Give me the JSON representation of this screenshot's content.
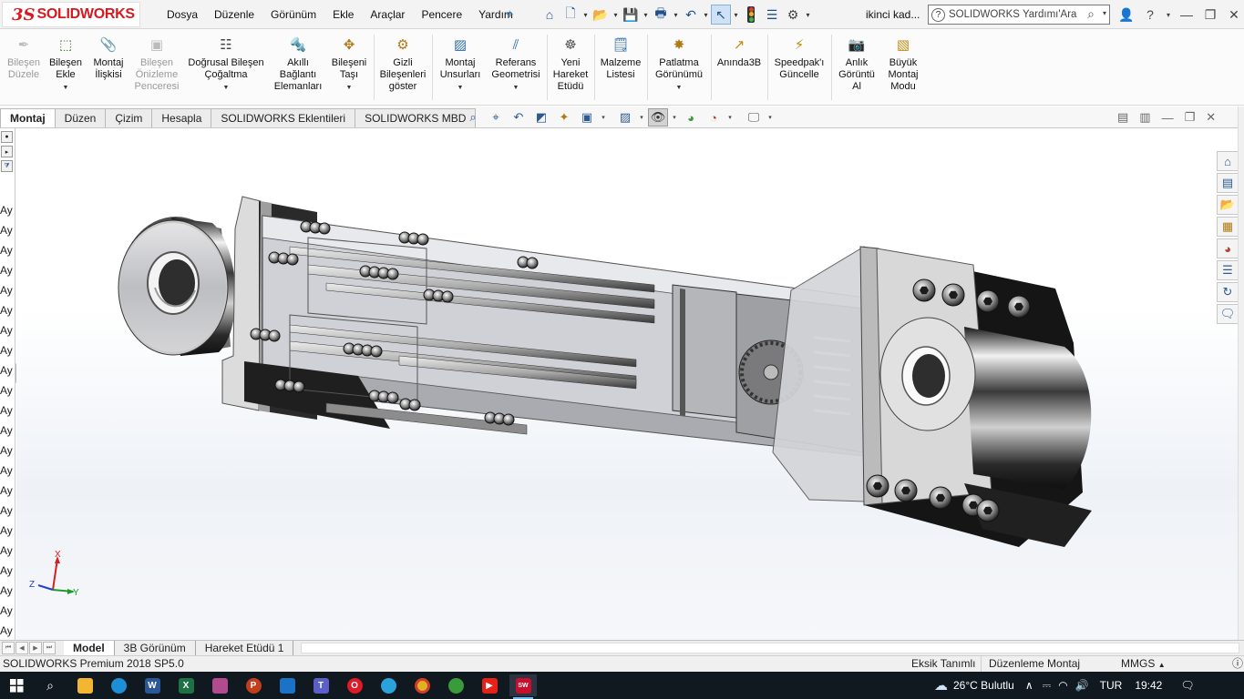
{
  "app": {
    "logo_ds": "3S",
    "logo_name": "SOLIDWORKS",
    "document_name": "ikinci kad...",
    "search_placeholder": "SOLIDWORKS Yardımı'Ara"
  },
  "menus": [
    "Dosya",
    "Düzenle",
    "Görünüm",
    "Ekle",
    "Araçlar",
    "Pencere",
    "Yardım"
  ],
  "commands": [
    {
      "label": "Bileşen\nDüzele",
      "icon": "edit-component-icon",
      "enabled": false
    },
    {
      "label": "Bileşen\nEkle",
      "icon": "insert-component-icon",
      "enabled": true
    },
    {
      "label": "Montaj\nİlişkisi",
      "icon": "mate-icon",
      "enabled": true
    },
    {
      "label": "Bileşen\nÖnizleme\nPenceresi",
      "icon": "component-preview-icon",
      "enabled": false
    },
    {
      "label": "Doğrusal Bileşen\nÇoğaltma",
      "icon": "linear-pattern-icon",
      "enabled": true
    },
    {
      "label": "Akıllı\nBağlantı\nElemanları",
      "icon": "smart-fasteners-icon",
      "enabled": true
    },
    {
      "label": "Bileşeni\nTaşı",
      "icon": "move-component-icon",
      "enabled": true
    },
    {
      "label": "Gizli\nBileşenleri\ngöster",
      "icon": "show-hidden-icon",
      "enabled": true
    },
    {
      "label": "Montaj\nUnsurları",
      "icon": "assembly-features-icon",
      "enabled": true
    },
    {
      "label": "Referans\nGeometrisi",
      "icon": "reference-geometry-icon",
      "enabled": true
    },
    {
      "label": "Yeni\nHareket\nEtüdü",
      "icon": "new-motion-study-icon",
      "enabled": true
    },
    {
      "label": "Malzeme\nListesi",
      "icon": "bill-of-materials-icon",
      "enabled": true
    },
    {
      "label": "Patlatma\nGörünümü",
      "icon": "exploded-view-icon",
      "enabled": true
    },
    {
      "label": "Anında3B",
      "icon": "instant3d-icon",
      "enabled": true
    },
    {
      "label": "Speedpak'ı\nGüncelle",
      "icon": "speedpak-icon",
      "enabled": true
    },
    {
      "label": "Anlık\nGörüntü\nAl",
      "icon": "snapshot-icon",
      "enabled": true
    },
    {
      "label": "Büyük\nMontaj\nModu",
      "icon": "large-assembly-icon",
      "enabled": true
    }
  ],
  "cmd_tabs": [
    "Montaj",
    "Düzen",
    "Çizim",
    "Hesapla",
    "SOLIDWORKS Eklentileri",
    "SOLIDWORKS MBD"
  ],
  "active_cmd_tab": "Montaj",
  "tree_items": [
    "Ay",
    "Ay",
    "Ay",
    "Ay",
    "Ay",
    "Ay",
    "Ay",
    "Ay",
    "Ay",
    "Ay",
    "Ay",
    "Ay",
    "Ay",
    "Ay",
    "Ay",
    "Ay",
    "Ay",
    "Ay",
    "Ay",
    "Ay",
    "Ay",
    "Ay"
  ],
  "triad": {
    "x": "X",
    "y": "Y",
    "z": "Z"
  },
  "model_tabs": [
    "Model",
    "3B Görünüm",
    "Hareket Etüdü 1"
  ],
  "active_model_tab": "Model",
  "status": {
    "product": "SOLIDWORKS Premium 2018 SP5.0",
    "definition": "Eksik Tanımlı",
    "mode": "Düzenleme Montaj",
    "units": "MMGS"
  },
  "taskbar": {
    "weather": "26°C  Bulutlu",
    "language": "TUR",
    "time": "19:42"
  }
}
